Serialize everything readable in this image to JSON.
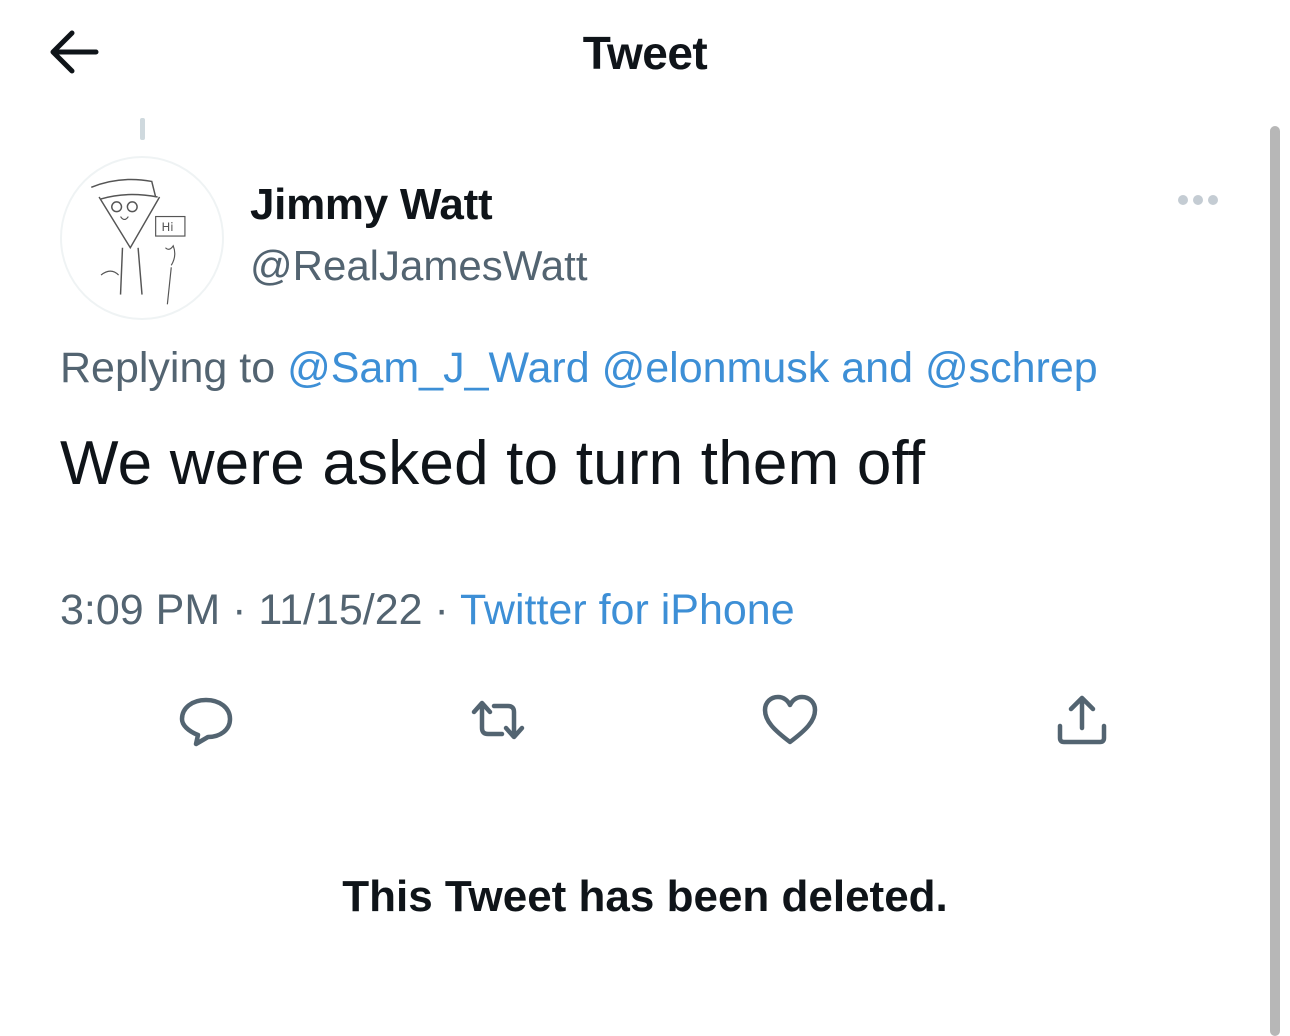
{
  "header": {
    "title": "Tweet",
    "back_icon": "arrow-left-icon"
  },
  "author": {
    "display_name": "Jimmy Watt",
    "handle": "@RealJamesWatt",
    "avatar_bubble_text": "Hi"
  },
  "reply": {
    "prefix": "Replying to",
    "mention1": "@Sam_J_Ward",
    "mention2": "@elonmusk",
    "conjunction": "and",
    "mention3": "@schrep"
  },
  "tweet": {
    "text": "We were asked to turn them off",
    "time": "3:09 PM",
    "separator": "·",
    "date": "11/15/22",
    "source": "Twitter for iPhone"
  },
  "actions": [
    {
      "icon": "reply-icon"
    },
    {
      "icon": "retweet-icon"
    },
    {
      "icon": "heart-icon"
    },
    {
      "icon": "share-icon"
    }
  ],
  "deleted_notice": "This Tweet has been deleted.",
  "colors": {
    "link": "#3d8fd6",
    "secondary": "#536471",
    "text": "#0f1419",
    "icon": "#536471"
  }
}
